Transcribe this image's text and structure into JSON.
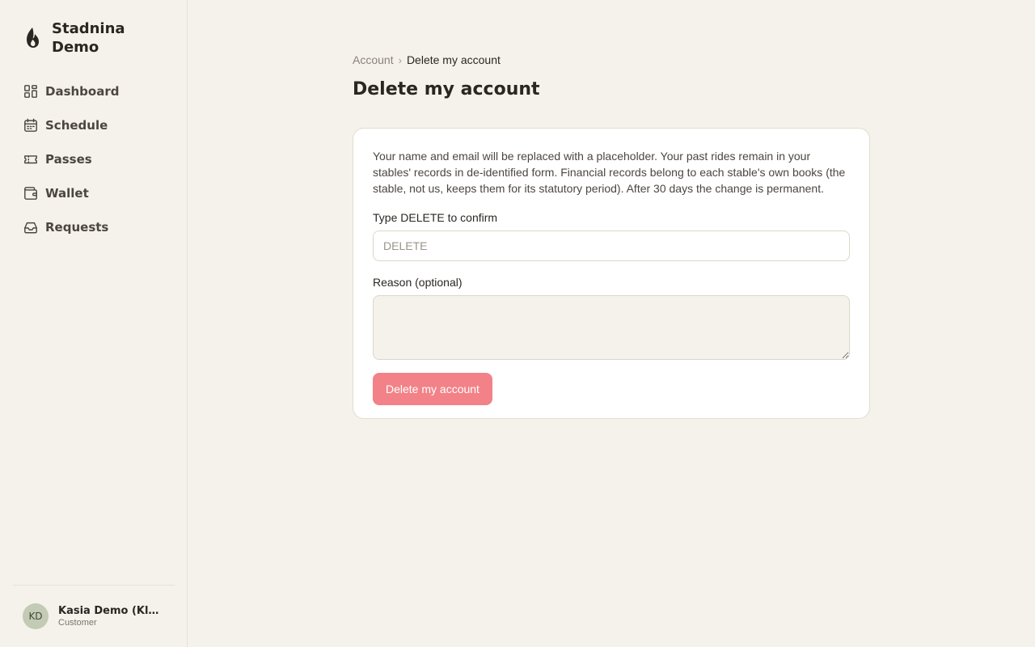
{
  "brand": {
    "name": "Stadnina Demo",
    "icon": "flame-icon"
  },
  "nav": {
    "items": [
      {
        "label": "Dashboard",
        "icon": "dashboard-icon"
      },
      {
        "label": "Schedule",
        "icon": "calendar-icon"
      },
      {
        "label": "Passes",
        "icon": "ticket-icon"
      },
      {
        "label": "Wallet",
        "icon": "wallet-icon"
      },
      {
        "label": "Requests",
        "icon": "inbox-icon"
      }
    ]
  },
  "user": {
    "initials": "KD",
    "name": "Kasia Demo (Klient)",
    "role": "Customer"
  },
  "breadcrumb": {
    "parent": "Account",
    "separator": "›",
    "current": "Delete my account"
  },
  "page": {
    "title": "Delete my account"
  },
  "form": {
    "description": "Your name and email will be replaced with a placeholder. Your past rides remain in your stables' records in de-identified form. Financial records belong to each stable's own books (the stable, not us, keeps them for its statutory period). After 30 days the change is permanent.",
    "confirm_label": "Type DELETE to confirm",
    "confirm_placeholder": "DELETE",
    "confirm_value": "",
    "reason_label": "Reason (optional)",
    "reason_value": "",
    "submit_label": "Delete my account"
  },
  "colors": {
    "danger": "#f28288",
    "background": "#f5f2eb"
  }
}
